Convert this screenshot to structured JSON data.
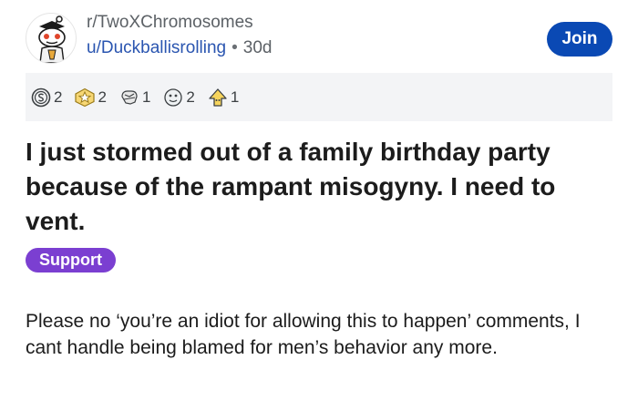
{
  "post": {
    "subreddit": "r/TwoXChromosomes",
    "username": "u/Duckballisrolling",
    "separator": "•",
    "age": "30d",
    "join_label": "Join",
    "title": "I just stormed out of a family birthday party because of the rampant misogyny. I need to vent.",
    "flair": "Support",
    "body": "Please no ‘you’re an idiot for allowing this to happen’ comments, I cant handle being blamed for men’s behavior any more."
  },
  "awards": [
    {
      "icon": "silver-award-icon",
      "count": "2"
    },
    {
      "icon": "gold-star-award-icon",
      "count": "2"
    },
    {
      "icon": "wholesome-award-icon",
      "count": "1"
    },
    {
      "icon": "helpful-award-icon",
      "count": "2"
    },
    {
      "icon": "upvote-award-icon",
      "count": "1"
    }
  ],
  "colors": {
    "join_button": "#0a49b4",
    "flair": "#7b3fd1",
    "username": "#2a55b0",
    "awards_bar": "#f3f4f6"
  }
}
